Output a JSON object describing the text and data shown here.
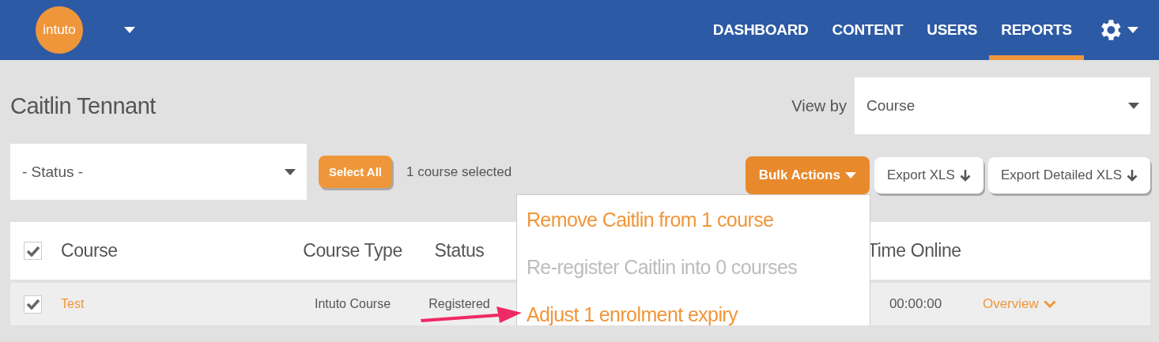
{
  "header": {
    "logo": "intuto",
    "nav": [
      {
        "label": "DASHBOARD",
        "selected": false
      },
      {
        "label": "CONTENT",
        "selected": false
      },
      {
        "label": "USERS",
        "selected": false
      },
      {
        "label": "REPORTS",
        "selected": true
      }
    ]
  },
  "page_title": "Caitlin Tennant",
  "view_by": {
    "label": "View by",
    "value": "Course"
  },
  "status_filter": {
    "value": "- Status -"
  },
  "select_all_button": "Select All",
  "selection_count": "1 course selected",
  "bulk_actions": {
    "label": "Bulk Actions",
    "expanded": true,
    "items": [
      {
        "label": "Remove Caitlin from 1 course",
        "disabled": false
      },
      {
        "label": "Re-register Caitlin into 0 courses",
        "disabled": true
      },
      {
        "label": "Adjust 1 enrolment expiry",
        "disabled": false
      }
    ]
  },
  "export_buttons": [
    "Export XLS",
    "Export Detailed XLS"
  ],
  "table": {
    "header_checked": true,
    "columns": [
      "Course",
      "Course Type",
      "Status",
      "Time Online"
    ],
    "rows": [
      {
        "checked": true,
        "course": "Test",
        "course_type": "Intuto Course",
        "status": "Registered",
        "time_online": "00:00:00",
        "action": "Overview"
      }
    ]
  }
}
